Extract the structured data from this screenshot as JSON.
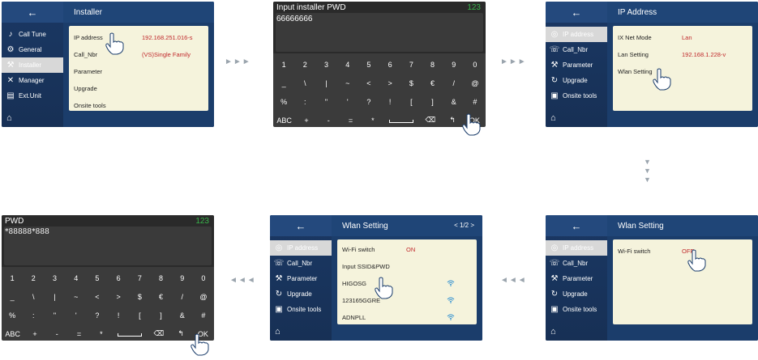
{
  "p1": {
    "back_glyph": "←",
    "title": "Installer",
    "sidebar": [
      "Call Tune",
      "General",
      "Installer",
      "Manager",
      "Ext.Unit"
    ],
    "rows": [
      {
        "label": "IP address",
        "value": "192.168.251.016-s"
      },
      {
        "label": "Call_Nbr",
        "value": "(VS)Single Family"
      },
      {
        "label": "Parameter",
        "value": ""
      },
      {
        "label": "Upgrade",
        "value": ""
      },
      {
        "label": "Onsite tools",
        "value": ""
      }
    ]
  },
  "p2": {
    "label": "Input installer PWD",
    "count": "123",
    "text": "66666666",
    "keys": [
      [
        "1",
        "2",
        "3",
        "4",
        "5",
        "6",
        "7",
        "8",
        "9",
        "0"
      ],
      [
        "_",
        "\\",
        "|",
        "~",
        "<",
        ">",
        "$",
        "€",
        "/",
        "@"
      ],
      [
        "%",
        ":",
        "\"",
        "'",
        "?",
        "!",
        "[",
        "]",
        "&",
        "#"
      ],
      [
        "ABC",
        "+",
        "-",
        "=",
        "*",
        "space",
        "⌫",
        "↰",
        "OK"
      ]
    ]
  },
  "p3": {
    "back_glyph": "←",
    "title": "IP Address",
    "sidebar": [
      "IP address",
      "Call_Nbr",
      "Parameter",
      "Upgrade",
      "Onsite tools"
    ],
    "rows": [
      {
        "label": "IX Net Mode",
        "value": "Lan"
      },
      {
        "label": "Lan Setting",
        "value": "192.168.1.228-v"
      },
      {
        "label": "Wlan Setting",
        "value": ""
      }
    ]
  },
  "p4": {
    "back_glyph": "←",
    "title": "Wlan Setting",
    "sidebar": [
      "IP address",
      "Call_Nbr",
      "Parameter",
      "Upgrade",
      "Onsite tools"
    ],
    "rows": [
      {
        "label": "Wi-Fi switch",
        "value": "OFF"
      }
    ]
  },
  "p5": {
    "back_glyph": "←",
    "title": "Wlan Setting",
    "pager": "< 1/2 >",
    "sidebar": [
      "IP address",
      "Call_Nbr",
      "Parameter",
      "Upgrade",
      "Onsite tools"
    ],
    "rows": [
      {
        "label": "Wi-Fi switch",
        "value": "ON"
      },
      {
        "label": "Input SSID&PWD",
        "value": ""
      },
      {
        "label": "HIGOSG",
        "value": ""
      },
      {
        "label": "123165GGRE",
        "value": ""
      },
      {
        "label": "ADNPLL",
        "value": ""
      }
    ]
  },
  "p6": {
    "label": "PWD",
    "count": "123",
    "text": "*88888*888"
  },
  "arrows": {
    "right": "►►►",
    "left": "◄◄◄",
    "down": "▼"
  },
  "colors": {
    "accent_red": "#c0282b",
    "green": "#38b34a",
    "panel_blue": "#1b3d6b"
  }
}
